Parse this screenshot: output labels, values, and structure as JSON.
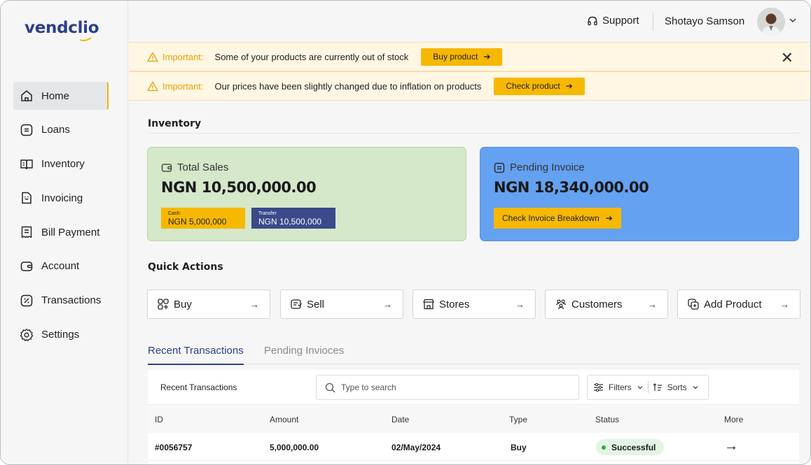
{
  "brand": {
    "name": "vendclio",
    "accent": "#f6b800",
    "primary": "#2d3f8c"
  },
  "sidebar": {
    "items": [
      {
        "label": "Home",
        "icon": "home-icon",
        "active": true
      },
      {
        "label": "Loans",
        "icon": "loans-icon"
      },
      {
        "label": "Inventory",
        "icon": "book-icon"
      },
      {
        "label": "Invoicing",
        "icon": "invoice-icon"
      },
      {
        "label": "Bill Payment",
        "icon": "bill-icon"
      },
      {
        "label": "Account",
        "icon": "wallet-icon"
      },
      {
        "label": "Transactions",
        "icon": "percent-icon"
      },
      {
        "label": "Settings",
        "icon": "gear-icon"
      }
    ]
  },
  "header": {
    "support_label": "Support",
    "user_name": "Shotayo Samson"
  },
  "banners": [
    {
      "tag": "Important:",
      "message": "Some of your products are currently out of stock",
      "button": "Buy product",
      "closable": true
    },
    {
      "tag": "Important:",
      "message": "Our prices have been slightly changed due to inflation on products",
      "button": "Check product",
      "closable": false
    }
  ],
  "inventory": {
    "title": "Inventory",
    "total_sales": {
      "label": "Total Sales",
      "amount": "NGN 10,500,000.00",
      "cash_label": "Cash:",
      "cash_value": "NGN 5,000,000",
      "transfer_label": "Transfer",
      "transfer_value": "NGN 10,500,000"
    },
    "pending_invoice": {
      "label": "Pending Invoice",
      "amount": "NGN 18,340,000.00",
      "button": "Check Invoice Breakdown"
    }
  },
  "quick_actions": {
    "title": "Quick Actions",
    "items": [
      {
        "label": "Buy",
        "icon": "buy-icon"
      },
      {
        "label": "Sell",
        "icon": "sell-icon"
      },
      {
        "label": "Stores",
        "icon": "store-icon"
      },
      {
        "label": "Customers",
        "icon": "customers-icon"
      },
      {
        "label": "Add Product",
        "icon": "add-product-icon"
      }
    ]
  },
  "tabs": [
    {
      "label": "Recent Transactions",
      "active": true
    },
    {
      "label": "Pending Invioces",
      "active": false
    }
  ],
  "table": {
    "title": "Recent  Transactions",
    "search_placeholder": "Type to search",
    "filters_label": "Filters",
    "sorts_label": "Sorts",
    "columns": [
      "ID",
      "Amount",
      "Date",
      "Type",
      "Status",
      "More"
    ],
    "rows": [
      {
        "id": "#0056757",
        "amount": "5,000,000.00",
        "date": "02/May/2024",
        "type": "Buy",
        "status": "Successful",
        "status_color": "#22b04b"
      }
    ]
  }
}
